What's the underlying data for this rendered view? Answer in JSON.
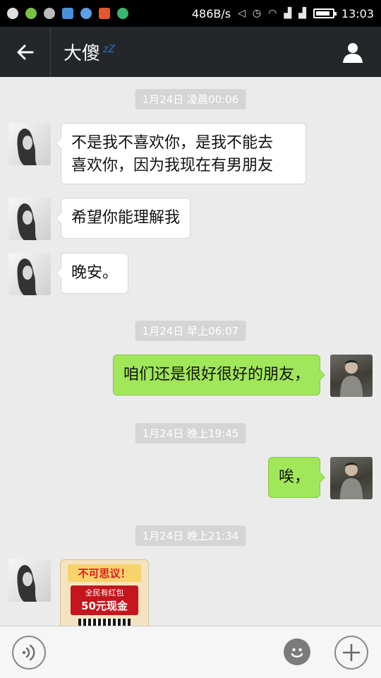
{
  "status_bar": {
    "net_speed": "486B/s",
    "time": "13:03",
    "battery_percent": 85
  },
  "header": {
    "title": "大傻",
    "sleep_indicator": "zZ",
    "back_icon": "arrow-left-icon",
    "profile_icon": "person-icon"
  },
  "messages": [
    {
      "type": "timestamp",
      "text": "1月24日 凌晨00:06"
    },
    {
      "type": "incoming",
      "text": "不是我不喜欢你，是我不能去\n喜欢你，因为我现在有男朋友"
    },
    {
      "type": "incoming",
      "text": "希望你能理解我"
    },
    {
      "type": "incoming",
      "text": "晚安。"
    },
    {
      "type": "timestamp",
      "text": "1月24日 早上06:07"
    },
    {
      "type": "outgoing",
      "text": "咱们还是很好很好的朋友，"
    },
    {
      "type": "timestamp",
      "text": "1月24日 晚上19:45"
    },
    {
      "type": "outgoing",
      "text": "唉，"
    },
    {
      "type": "timestamp",
      "text": "1月24日 晚上21:34"
    },
    {
      "type": "incoming_image",
      "head": "不可思议！",
      "line1": "全民有红包",
      "line2": "50元现金"
    }
  ],
  "input_bar": {
    "voice_icon": "voice-wave-icon",
    "emoji_icon": "smiley-icon",
    "more_icon": "plus-icon"
  },
  "colors": {
    "outgoing_bubble": "#a0e75a",
    "incoming_bubble": "#ffffff",
    "header_bg": "#23272a",
    "chat_bg": "#ebebeb"
  }
}
